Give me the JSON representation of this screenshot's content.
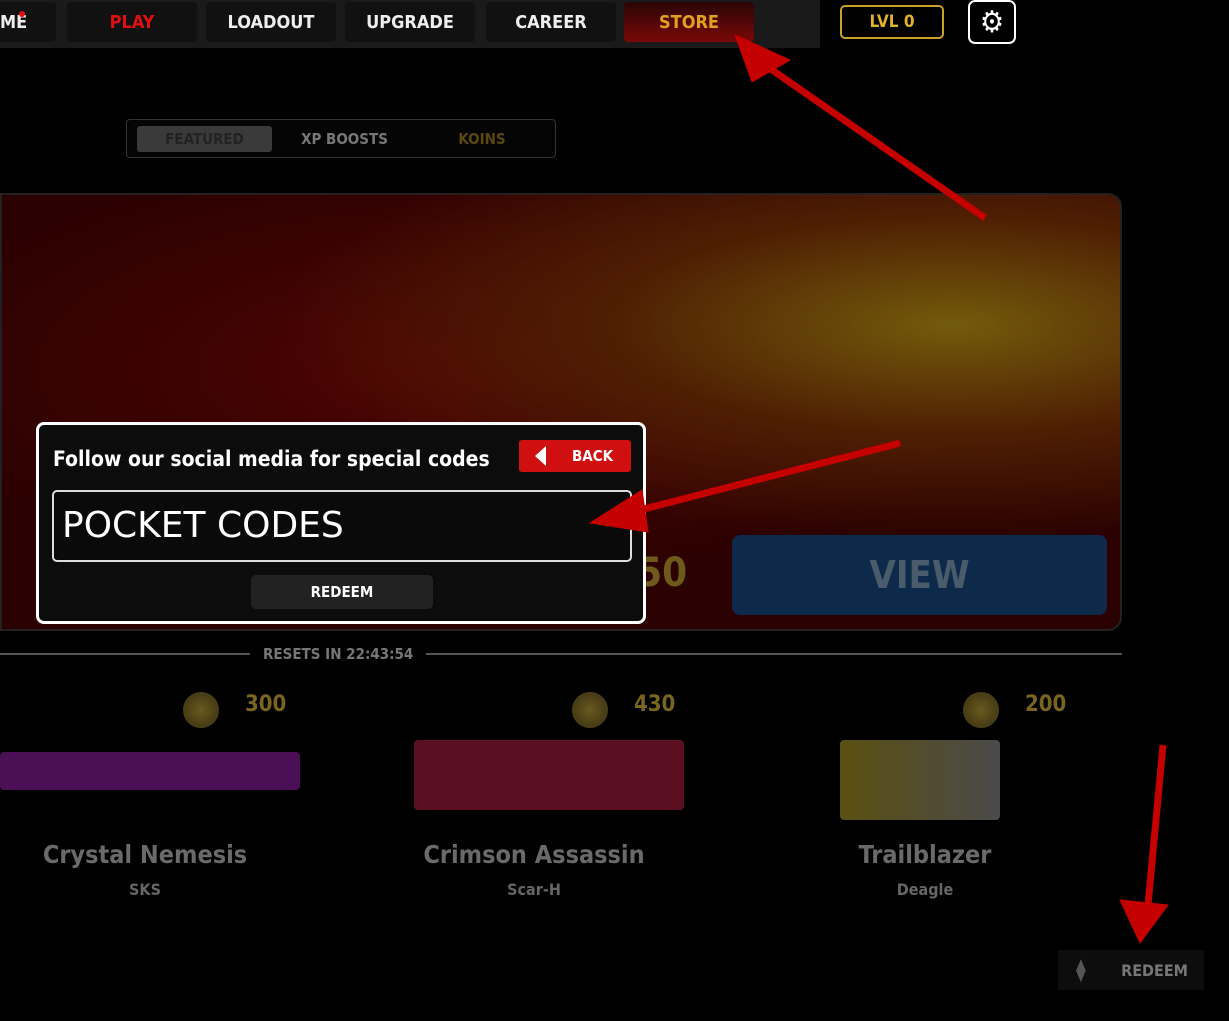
{
  "nav": {
    "tabs": [
      "ME",
      "PLAY",
      "LOADOUT",
      "UPGRADE",
      "CAREER",
      "STORE"
    ],
    "level": "LVL 0",
    "settings_icon": "gear-icon"
  },
  "store_tabs": [
    "FEATURED",
    "XP BOOSTS",
    "KOINS"
  ],
  "banner": {
    "price": "1850",
    "view_label": "VIEW"
  },
  "dialog": {
    "title": "Follow our social media for special codes",
    "back_label": "BACK",
    "code_value": "POCKET CODES",
    "redeem_label": "REDEEM"
  },
  "resets": "RESETS IN 22:43:54",
  "items": [
    {
      "name": "Crystal Nemesis",
      "weapon": "SKS",
      "price": "300"
    },
    {
      "name": "Crimson Assassin",
      "weapon": "Scar-H",
      "price": "430"
    },
    {
      "name": "Trailblazer",
      "weapon": "Deagle",
      "price": "200"
    }
  ],
  "redeem_button": "REDEEM",
  "colors": {
    "accent_red": "#d01010",
    "gold": "#e0b328",
    "arrow": "#c00000"
  }
}
